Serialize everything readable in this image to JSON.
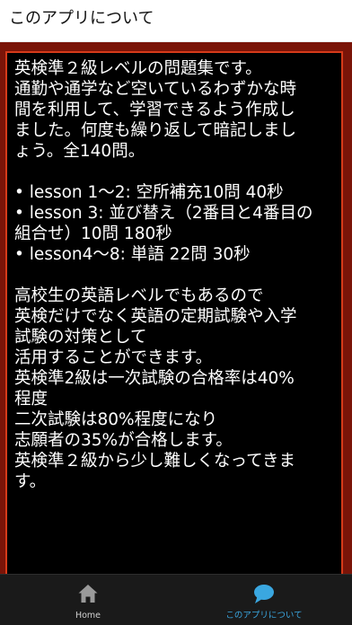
{
  "header": {
    "title": "このアプリについて"
  },
  "content": {
    "lines": [
      "英検準２級レベルの問題集です。",
      "通勤や通学など空いているわずかな時",
      "間を利用して、学習できるよう作成し",
      "ました。何度も繰り返して暗記しまし",
      "ょう。全140問。",
      "",
      " • lesson 1～2: 空所補充10問 40秒",
      " • lesson 3: 並び替え（2番目と4番目の",
      "組合せ）10問 180秒",
      " • lesson4～8: 単語 22問 30秒",
      "",
      "高校生の英語レベルでもあるので",
      "英検だけでなく英語の定期試験や入学",
      "試験の対策として",
      "活用することができます。",
      "英検準2級は一次試験の合格率は40%",
      "程度",
      "二次試験は80%程度になり",
      "志願者の35%が合格します。",
      "英検準２級から少し難しくなってきま",
      "す。"
    ]
  },
  "bottom_nav": {
    "items": [
      {
        "label": "Home",
        "icon": "home-icon",
        "active": false
      },
      {
        "label": "このアプリについて",
        "icon": "chat-bubble-icon",
        "active": true
      }
    ]
  },
  "colors": {
    "background_frame": "#7a1408",
    "content_border": "#d63a1a",
    "content_background": "#000000",
    "text": "#ffffff",
    "nav_background": "#1a1a1a",
    "nav_active": "#3aa7e0",
    "nav_inactive": "#cfcfcf"
  }
}
